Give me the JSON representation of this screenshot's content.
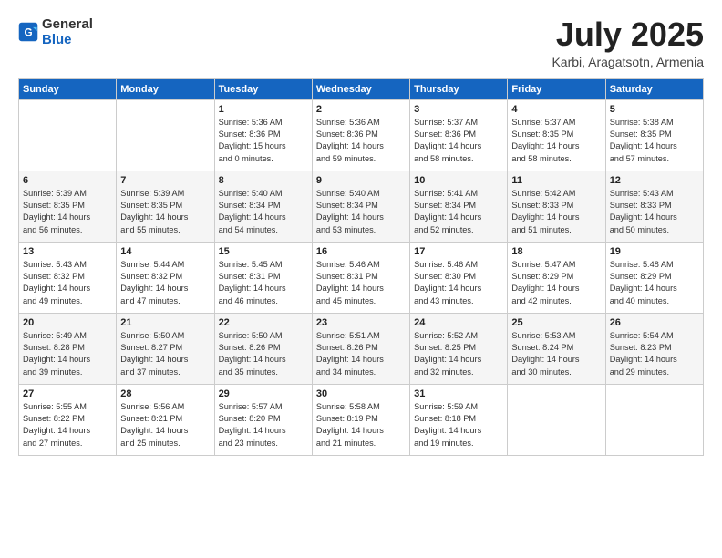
{
  "header": {
    "logo_general": "General",
    "logo_blue": "Blue",
    "month": "July 2025",
    "location": "Karbi, Aragatsotn, Armenia"
  },
  "days_of_week": [
    "Sunday",
    "Monday",
    "Tuesday",
    "Wednesday",
    "Thursday",
    "Friday",
    "Saturday"
  ],
  "weeks": [
    [
      {
        "day": "",
        "info": ""
      },
      {
        "day": "",
        "info": ""
      },
      {
        "day": "1",
        "info": "Sunrise: 5:36 AM\nSunset: 8:36 PM\nDaylight: 15 hours\nand 0 minutes."
      },
      {
        "day": "2",
        "info": "Sunrise: 5:36 AM\nSunset: 8:36 PM\nDaylight: 14 hours\nand 59 minutes."
      },
      {
        "day": "3",
        "info": "Sunrise: 5:37 AM\nSunset: 8:36 PM\nDaylight: 14 hours\nand 58 minutes."
      },
      {
        "day": "4",
        "info": "Sunrise: 5:37 AM\nSunset: 8:35 PM\nDaylight: 14 hours\nand 58 minutes."
      },
      {
        "day": "5",
        "info": "Sunrise: 5:38 AM\nSunset: 8:35 PM\nDaylight: 14 hours\nand 57 minutes."
      }
    ],
    [
      {
        "day": "6",
        "info": "Sunrise: 5:39 AM\nSunset: 8:35 PM\nDaylight: 14 hours\nand 56 minutes."
      },
      {
        "day": "7",
        "info": "Sunrise: 5:39 AM\nSunset: 8:35 PM\nDaylight: 14 hours\nand 55 minutes."
      },
      {
        "day": "8",
        "info": "Sunrise: 5:40 AM\nSunset: 8:34 PM\nDaylight: 14 hours\nand 54 minutes."
      },
      {
        "day": "9",
        "info": "Sunrise: 5:40 AM\nSunset: 8:34 PM\nDaylight: 14 hours\nand 53 minutes."
      },
      {
        "day": "10",
        "info": "Sunrise: 5:41 AM\nSunset: 8:34 PM\nDaylight: 14 hours\nand 52 minutes."
      },
      {
        "day": "11",
        "info": "Sunrise: 5:42 AM\nSunset: 8:33 PM\nDaylight: 14 hours\nand 51 minutes."
      },
      {
        "day": "12",
        "info": "Sunrise: 5:43 AM\nSunset: 8:33 PM\nDaylight: 14 hours\nand 50 minutes."
      }
    ],
    [
      {
        "day": "13",
        "info": "Sunrise: 5:43 AM\nSunset: 8:32 PM\nDaylight: 14 hours\nand 49 minutes."
      },
      {
        "day": "14",
        "info": "Sunrise: 5:44 AM\nSunset: 8:32 PM\nDaylight: 14 hours\nand 47 minutes."
      },
      {
        "day": "15",
        "info": "Sunrise: 5:45 AM\nSunset: 8:31 PM\nDaylight: 14 hours\nand 46 minutes."
      },
      {
        "day": "16",
        "info": "Sunrise: 5:46 AM\nSunset: 8:31 PM\nDaylight: 14 hours\nand 45 minutes."
      },
      {
        "day": "17",
        "info": "Sunrise: 5:46 AM\nSunset: 8:30 PM\nDaylight: 14 hours\nand 43 minutes."
      },
      {
        "day": "18",
        "info": "Sunrise: 5:47 AM\nSunset: 8:29 PM\nDaylight: 14 hours\nand 42 minutes."
      },
      {
        "day": "19",
        "info": "Sunrise: 5:48 AM\nSunset: 8:29 PM\nDaylight: 14 hours\nand 40 minutes."
      }
    ],
    [
      {
        "day": "20",
        "info": "Sunrise: 5:49 AM\nSunset: 8:28 PM\nDaylight: 14 hours\nand 39 minutes."
      },
      {
        "day": "21",
        "info": "Sunrise: 5:50 AM\nSunset: 8:27 PM\nDaylight: 14 hours\nand 37 minutes."
      },
      {
        "day": "22",
        "info": "Sunrise: 5:50 AM\nSunset: 8:26 PM\nDaylight: 14 hours\nand 35 minutes."
      },
      {
        "day": "23",
        "info": "Sunrise: 5:51 AM\nSunset: 8:26 PM\nDaylight: 14 hours\nand 34 minutes."
      },
      {
        "day": "24",
        "info": "Sunrise: 5:52 AM\nSunset: 8:25 PM\nDaylight: 14 hours\nand 32 minutes."
      },
      {
        "day": "25",
        "info": "Sunrise: 5:53 AM\nSunset: 8:24 PM\nDaylight: 14 hours\nand 30 minutes."
      },
      {
        "day": "26",
        "info": "Sunrise: 5:54 AM\nSunset: 8:23 PM\nDaylight: 14 hours\nand 29 minutes."
      }
    ],
    [
      {
        "day": "27",
        "info": "Sunrise: 5:55 AM\nSunset: 8:22 PM\nDaylight: 14 hours\nand 27 minutes."
      },
      {
        "day": "28",
        "info": "Sunrise: 5:56 AM\nSunset: 8:21 PM\nDaylight: 14 hours\nand 25 minutes."
      },
      {
        "day": "29",
        "info": "Sunrise: 5:57 AM\nSunset: 8:20 PM\nDaylight: 14 hours\nand 23 minutes."
      },
      {
        "day": "30",
        "info": "Sunrise: 5:58 AM\nSunset: 8:19 PM\nDaylight: 14 hours\nand 21 minutes."
      },
      {
        "day": "31",
        "info": "Sunrise: 5:59 AM\nSunset: 8:18 PM\nDaylight: 14 hours\nand 19 minutes."
      },
      {
        "day": "",
        "info": ""
      },
      {
        "day": "",
        "info": ""
      }
    ]
  ]
}
